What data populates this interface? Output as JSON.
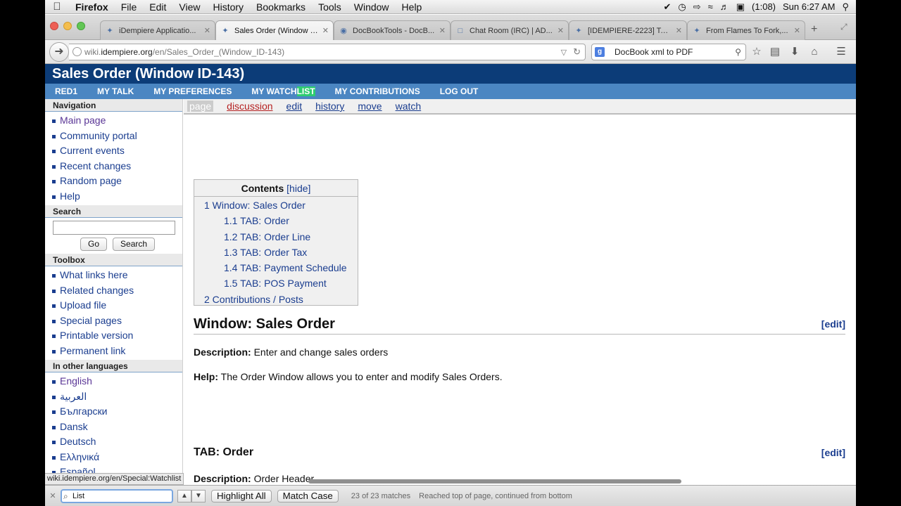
{
  "menubar": {
    "app": "Firefox",
    "items": [
      "File",
      "Edit",
      "View",
      "History",
      "Bookmarks",
      "Tools",
      "Window",
      "Help"
    ],
    "battery": "(1:08)",
    "clock": "Sun 6:27 AM"
  },
  "tabs": [
    {
      "title": "iDempiere Applicatio...",
      "active": false
    },
    {
      "title": "Sales Order (Window I...",
      "active": true
    },
    {
      "title": "DocBookTools - DocB...",
      "active": false
    },
    {
      "title": "Chat Room (IRC) | AD...",
      "active": false
    },
    {
      "title": "[IDEMPIERE-2223] To ...",
      "active": false
    },
    {
      "title": "From Flames To Fork,...",
      "active": false
    }
  ],
  "urlbar": {
    "prefix": "wiki.",
    "host": "idempiere.org",
    "path": "/en/Sales_Order_(Window_ID-143)"
  },
  "searchbar": {
    "value": "DocBook xml to PDF"
  },
  "page": {
    "title": "Sales Order (Window ID-143)",
    "usermenu": {
      "items": [
        "RED1",
        "MY TALK",
        "MY PREFERENCES"
      ],
      "watch_a": "MY WATCH",
      "watch_b": "LIST",
      "items2": [
        "MY CONTRIBUTIONS",
        "LOG OUT"
      ]
    },
    "page_tabs": [
      "page",
      "discussion",
      "edit",
      "history",
      "move",
      "watch"
    ],
    "sidebar": {
      "navigation_title": "Navigation",
      "navigation": [
        "Main page",
        "Community portal",
        "Current events",
        "Recent changes",
        "Random page",
        "Help"
      ],
      "search_title": "Search",
      "go_label": "Go",
      "search_label": "Search",
      "toolbox_title": "Toolbox",
      "toolbox": [
        "What links here",
        "Related changes",
        "Upload file",
        "Special pages",
        "Printable version",
        "Permanent link"
      ],
      "languages_title": "In other languages",
      "languages": [
        "English",
        "العربية",
        "Български",
        "Dansk",
        "Deutsch",
        "Ελληνικά",
        "Español"
      ]
    },
    "toc": {
      "title": "Contents",
      "hide": "[hide]",
      "items": [
        "1 Window: Sales Order",
        "1.1 TAB: Order",
        "1.2 TAB: Order Line",
        "1.3 TAB: Order Tax",
        "1.4 TAB: Payment Schedule",
        "1.5 TAB: POS Payment",
        "2 Contributions / Posts"
      ]
    },
    "section1": {
      "heading": "Window: Sales Order",
      "edit": "[edit]",
      "desc_label": "Description:",
      "desc": " Enter and change sales orders",
      "help_label": "Help:",
      "help": " The Order Window allows you to enter and modify Sales Orders."
    },
    "section2": {
      "heading": "TAB: Order",
      "edit": "[edit]",
      "desc_label": "Description:",
      "desc": " Order Header"
    },
    "status_link": "wiki.idempiere.org/en/Special:Watchlist"
  },
  "findbar": {
    "query": "List",
    "highlight_label": "Highlight All",
    "match_case_label": "Match Case",
    "matches": "23 of 23 matches",
    "status": "Reached top of page, continued from bottom"
  }
}
